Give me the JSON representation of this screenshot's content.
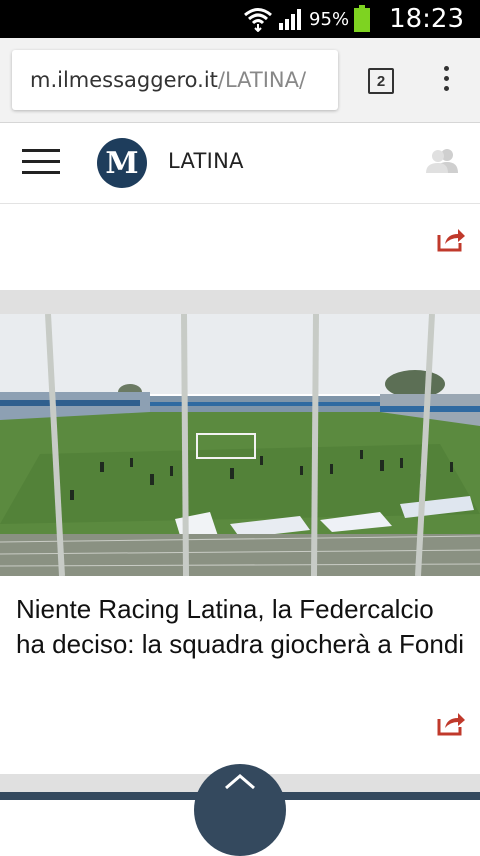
{
  "status_bar": {
    "battery_percent": "95%",
    "time": "18:23",
    "icons": [
      "wifi-icon",
      "signal-icon",
      "battery-icon"
    ]
  },
  "browser": {
    "url_domain": "m.ilmessaggero.it",
    "url_path": "/LATINA/",
    "tab_count": "2"
  },
  "site_header": {
    "logo_letter": "M",
    "section": "LATINA"
  },
  "article": {
    "headline": "Niente Racing Latina, la Federcalcio ha deciso: la squadra giocherà a Fondi"
  },
  "colors": {
    "accent_share": "#c0392b",
    "logo_bg": "#1e3d5c",
    "bottom_bar": "#34495e"
  }
}
